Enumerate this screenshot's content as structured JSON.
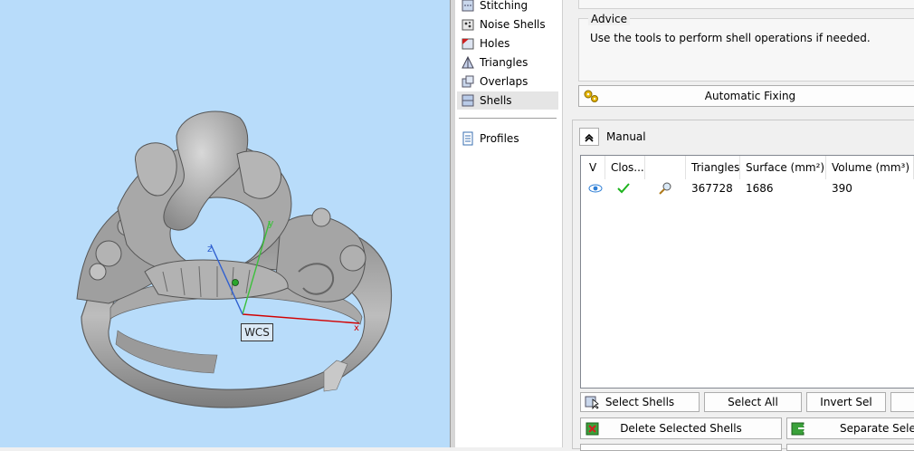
{
  "viewport": {
    "wcs_label": "WCS",
    "background_color": "#b8dcfa",
    "model": "ring-3d-model"
  },
  "tree": {
    "items": [
      {
        "label": "Stitching",
        "icon": "stitching-icon"
      },
      {
        "label": "Noise Shells",
        "icon": "noise-shells-icon"
      },
      {
        "label": "Holes",
        "icon": "holes-icon"
      },
      {
        "label": "Triangles",
        "icon": "triangles-icon"
      },
      {
        "label": "Overlaps",
        "icon": "overlaps-icon"
      },
      {
        "label": "Shells",
        "icon": "shells-icon",
        "selected": true
      }
    ],
    "profiles": {
      "label": "Profiles",
      "icon": "profiles-icon"
    }
  },
  "advice": {
    "title": "Advice",
    "text": "Use the tools to perform shell operations if needed."
  },
  "automatic_fixing": {
    "label": "Automatic Fixing",
    "icon": "gears-icon"
  },
  "manual": {
    "label": "Manual",
    "toggle_icon": "collapse-up-icon"
  },
  "table": {
    "columns": [
      "V",
      "Clos...",
      "",
      "Triangles",
      "Surface (mm²)",
      "Volume (mm³)"
    ],
    "rows": [
      {
        "visible_icon": "eye-icon",
        "closed_icon": "checkmark-icon",
        "zoom_icon": "magnifier-icon",
        "triangles": "367728",
        "surface": "1686",
        "volume": "390"
      }
    ]
  },
  "buttons": {
    "select_shells": "Select Shells",
    "select_all": "Select All",
    "invert_sel": "Invert Sel",
    "delete_selected": "Delete Selected Shells",
    "separate_selected": "Separate Selecte"
  },
  "colors": {
    "accent_green": "#1db31d",
    "axis_x": "#d20000",
    "axis_y": "#3cc03c",
    "axis_z": "#3060d0"
  }
}
